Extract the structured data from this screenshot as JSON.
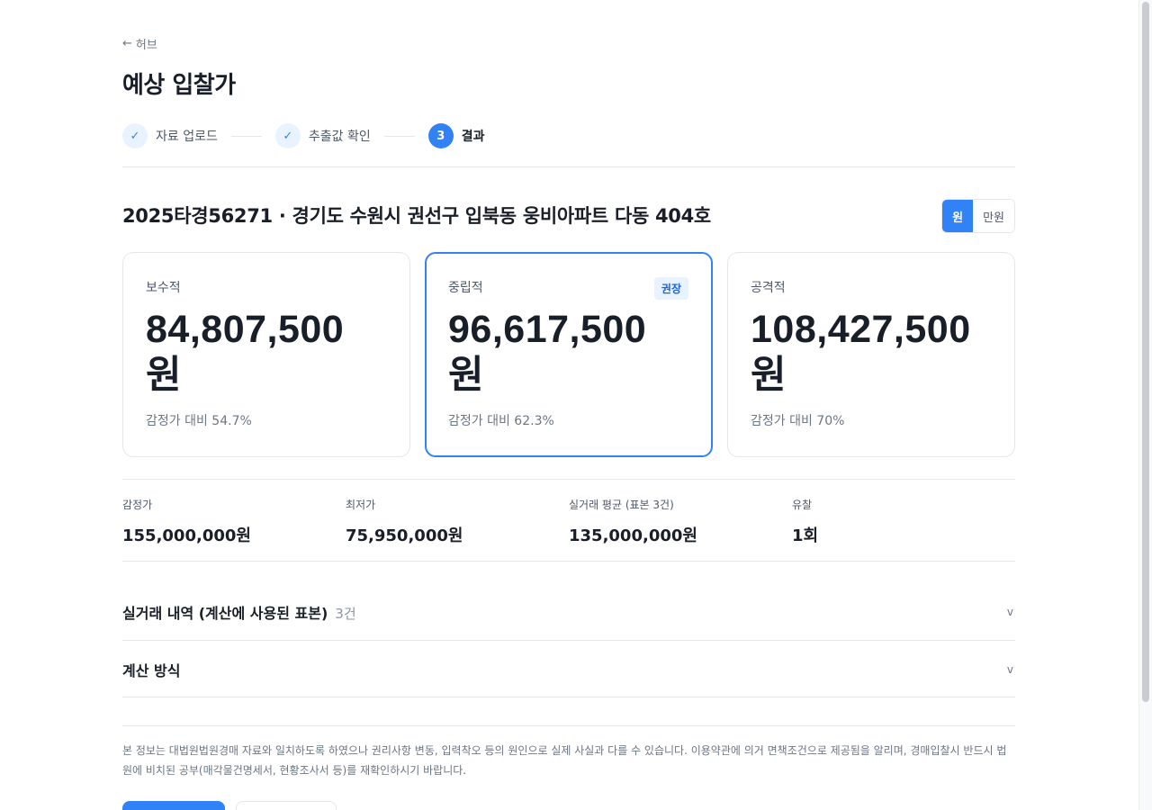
{
  "nav": {
    "back_label": "허브",
    "back_icon": "arrow-left-icon"
  },
  "page_title": "예상 입찰가",
  "steps": [
    {
      "number": "1",
      "label": "자료 업로드",
      "state": "done"
    },
    {
      "number": "2",
      "label": "추출값 확인",
      "state": "done"
    },
    {
      "number": "3",
      "label": "결과",
      "state": "active"
    }
  ],
  "case": {
    "title": "2025타경56271 · 경기도 수원시 권선구 입북동 웅비아파트 다동 404호"
  },
  "unit_toggle": {
    "options": [
      "원",
      "만원"
    ],
    "selected": "원"
  },
  "cards": [
    {
      "label": "보수적",
      "amount": "84,807,500",
      "unit": "원",
      "ratio": "감정가 대비 54.7%"
    },
    {
      "label": "중립적",
      "amount": "96,617,500",
      "unit": "원",
      "ratio": "감정가 대비 62.3%",
      "badge": "권장"
    },
    {
      "label": "공격적",
      "amount": "108,427,500",
      "unit": "원",
      "ratio": "감정가 대비 70%"
    }
  ],
  "stats": [
    {
      "label": "감정가",
      "value": "155,000,000원"
    },
    {
      "label": "최저가",
      "value": "75,950,000원"
    },
    {
      "label": "실거래 평균 (표본 3건)",
      "value": "135,000,000원"
    },
    {
      "label": "유찰",
      "value": "1회"
    }
  ],
  "accordions": [
    {
      "title": "실거래 내역 (계산에 사용된 표본)",
      "count": "3건"
    },
    {
      "title": "계산 방식",
      "count": ""
    }
  ],
  "disclaimer": "본 정보는 대법원법원경매 자료와 일치하도록 하였으나 권리사항 변동, 입력착오 등의 원인으로 실제 사실과 다를 수 있습니다. 이용약관에 의거 면책조건으로 제공됨을 알리며, 경매입찰시 반드시 법원에 비치된 공부(매각물건명세서, 현황조사서 등)를 재확인하시기 바랍니다.",
  "colors": {
    "accent": "#3182f6",
    "accent_light": "#e8f3ff",
    "text_primary": "#191f28",
    "text_secondary": "#4e5968",
    "border": "#e5e8eb"
  },
  "icons": {
    "step_done": "check-icon",
    "accordion": "chevron-down-icon"
  }
}
